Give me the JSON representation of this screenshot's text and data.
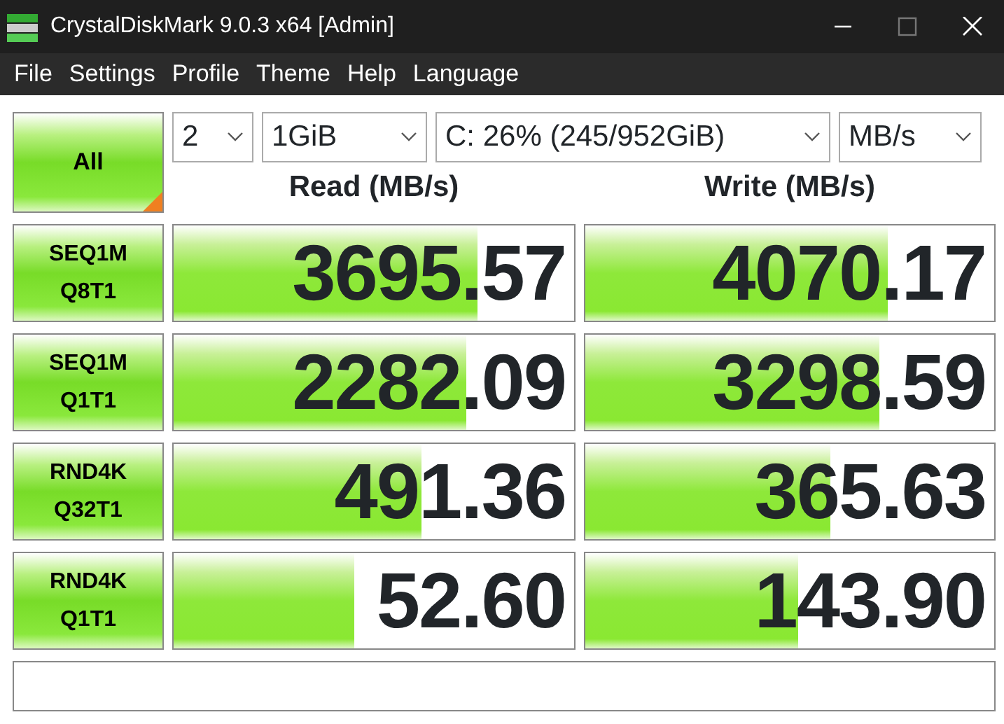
{
  "window": {
    "title": "CrystalDiskMark 9.0.3 x64 [Admin]"
  },
  "menu": [
    "File",
    "Settings",
    "Profile",
    "Theme",
    "Help",
    "Language"
  ],
  "all_button": {
    "label": "All"
  },
  "selects": [
    {
      "value": "2"
    },
    {
      "value": "1GiB"
    },
    {
      "value": "C: 26% (245/952GiB)"
    },
    {
      "value": "MB/s"
    }
  ],
  "headers": [
    "Read (MB/s)",
    "Write (MB/s)"
  ],
  "tests": [
    {
      "line1": "SEQ1M",
      "line2": "Q8T1",
      "read": {
        "value": "3695.57",
        "level": 0.76
      },
      "write": {
        "value": "4070.17",
        "level": 0.74
      }
    },
    {
      "line1": "SEQ1M",
      "line2": "Q1T1",
      "read": {
        "value": "2282.09",
        "level": 0.73
      },
      "write": {
        "value": "3298.59",
        "level": 0.72
      }
    },
    {
      "line1": "RND4K",
      "line2": "Q32T1",
      "read": {
        "value": "491.36",
        "level": 0.62
      },
      "write": {
        "value": "365.63",
        "level": 0.6
      }
    },
    {
      "line1": "RND4K",
      "line2": "Q1T1",
      "read": {
        "value": "52.60",
        "level": 0.45
      },
      "write": {
        "value": "143.90",
        "level": 0.52
      }
    }
  ]
}
